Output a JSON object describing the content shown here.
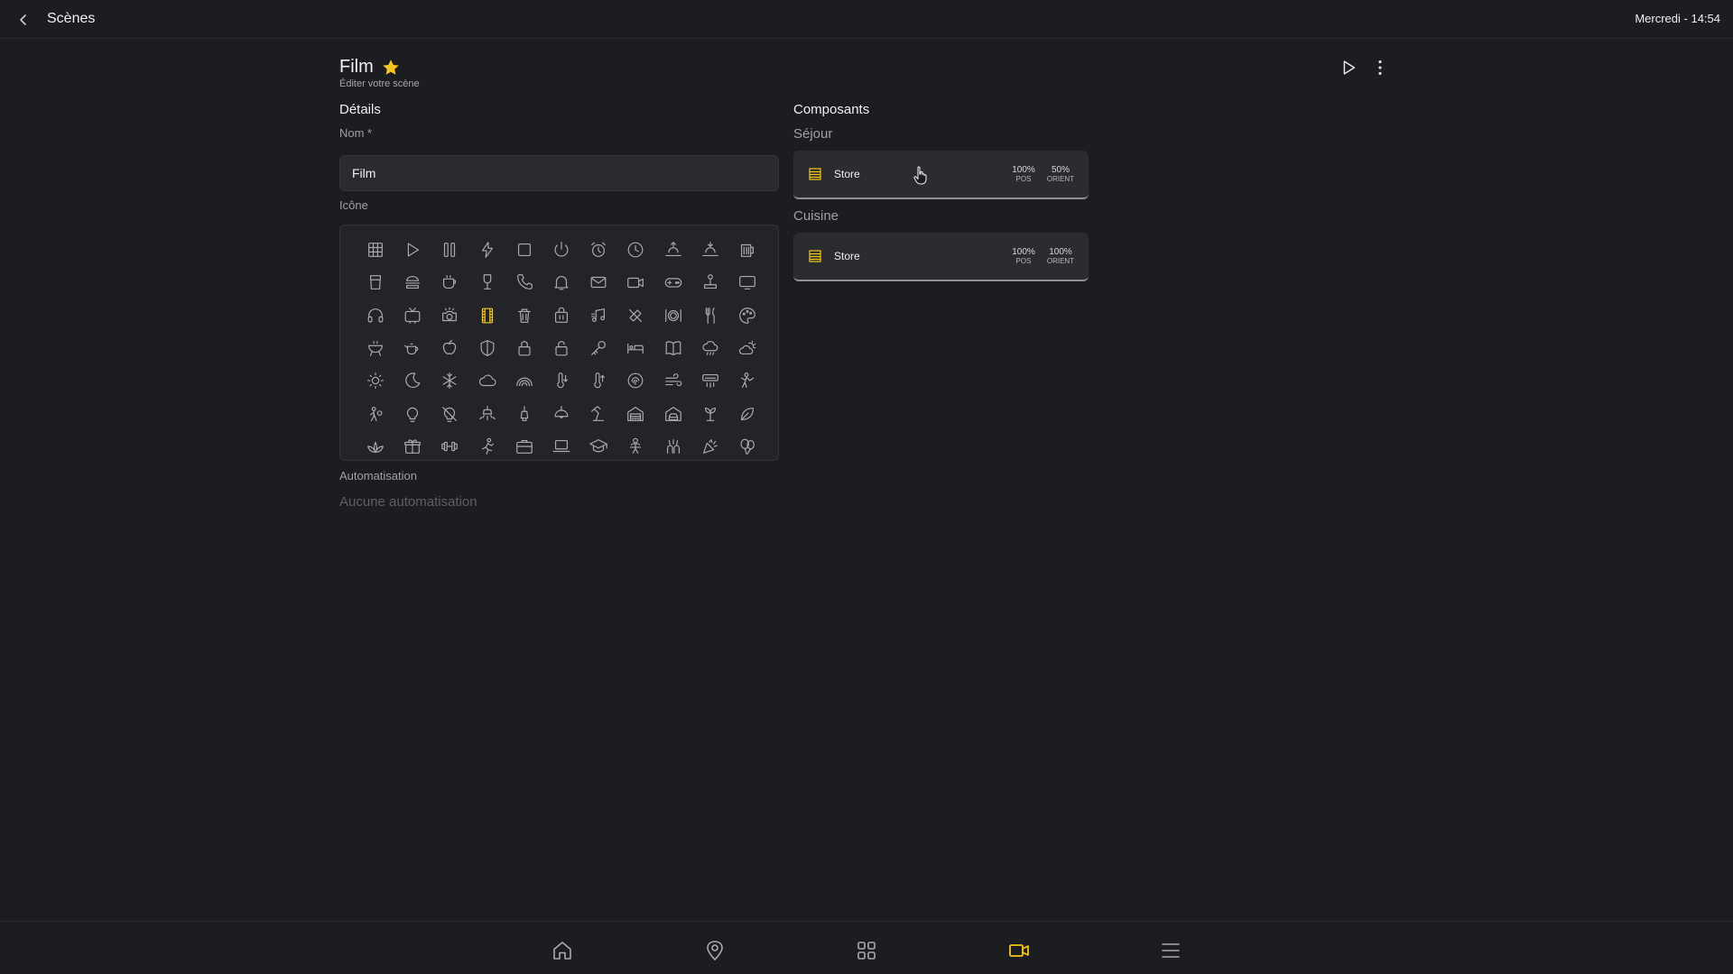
{
  "topbar": {
    "title": "Scènes",
    "clock": "Mercredi - 14:54"
  },
  "scene": {
    "name": "Film",
    "subtitle": "Éditer votre scène",
    "favorite": true
  },
  "details": {
    "heading": "Détails",
    "name_label": "Nom *",
    "name_value": "Film",
    "icon_label": "Icône",
    "selected_icon": "film-icon",
    "icons": [
      [
        "grid",
        "play",
        "pause",
        "bolt",
        "stop",
        "power",
        "alarm",
        "clock",
        "sunrise",
        "sunset",
        "beer"
      ],
      [
        "cocktail-glass",
        "hamburger",
        "coffee-cup",
        "wine-glass",
        "phone",
        "bell",
        "mail",
        "video-camera",
        "gamepad",
        "joystick",
        "monitor"
      ],
      [
        "headphones",
        "tv",
        "camera-flash",
        "film",
        "trash",
        "bag",
        "music-note",
        "tools",
        "plate-dining",
        "fork-knife",
        "paint-palette"
      ],
      [
        "bbq-grill",
        "teapot",
        "apple",
        "shield",
        "lock",
        "unlock",
        "key",
        "bed",
        "book",
        "cloud-rain",
        "cloud-sun"
      ],
      [
        "sun",
        "moon",
        "snowflake",
        "cloud",
        "rainbow",
        "thermometer-down",
        "thermometer-up",
        "fingerprint",
        "wind",
        "air-conditioner",
        "person-waving"
      ],
      [
        "person-gear",
        "light-bulb",
        "light-bulb-off",
        "ceiling-light",
        "pendant-lamp",
        "ceiling-lamp",
        "desk-lamp",
        "garage",
        "garage-car",
        "plant-sprout",
        "leaf"
      ],
      [
        "lotus",
        "gift",
        "dumbbell",
        "running",
        "briefcase",
        "laptop",
        "graduation-cap",
        "baby",
        "celebration-hand",
        "party-popper",
        "balloons"
      ]
    ],
    "automation_label": "Automatisation",
    "automation_empty": "Aucune automatisation"
  },
  "components": {
    "heading": "Composants",
    "rooms": [
      {
        "name": "Séjour",
        "items": [
          {
            "name": "Store",
            "pos_value": "100%",
            "pos_label": "POS",
            "orient_value": "50%",
            "orient_label": "ORIENT"
          }
        ]
      },
      {
        "name": "Cuisine",
        "items": [
          {
            "name": "Store",
            "pos_value": "100%",
            "pos_label": "POS",
            "orient_value": "100%",
            "orient_label": "ORIENT"
          }
        ]
      }
    ]
  },
  "bottom_nav": [
    {
      "name": "home-icon",
      "active": false
    },
    {
      "name": "location-pin-icon",
      "active": false
    },
    {
      "name": "apps-grid-icon",
      "active": false
    },
    {
      "name": "scenes-camera-icon",
      "active": true
    },
    {
      "name": "menu-icon",
      "active": false
    }
  ],
  "colors": {
    "background": "#1c1d21",
    "accent": "#f5c518",
    "panel": "#2b2c30",
    "text": "#e6e6e6",
    "muted": "#9fa0a4",
    "icon": "#a9aaae"
  }
}
